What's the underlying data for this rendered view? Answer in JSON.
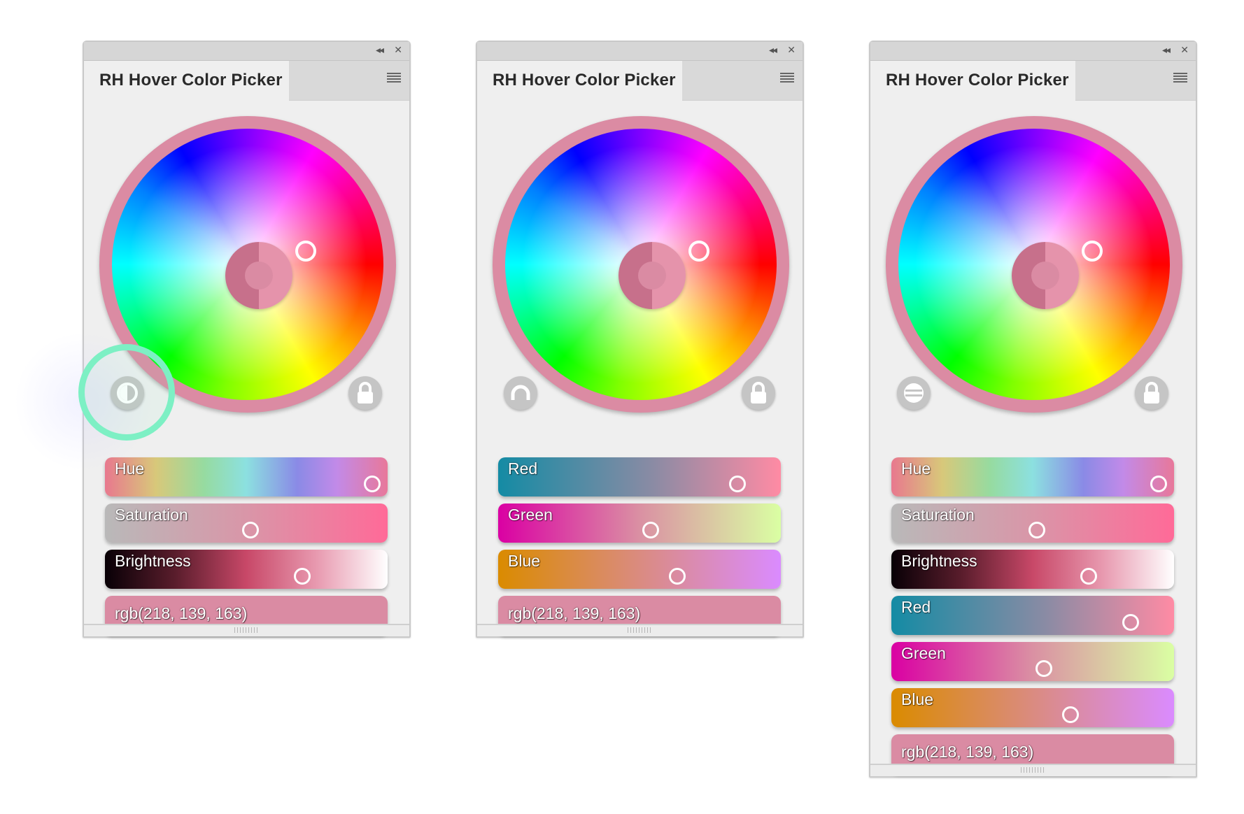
{
  "panels": [
    {
      "title": "RH Hover Color Picker",
      "collapse_icon": "double-chevron-left-icon",
      "close_icon": "close-icon",
      "menu_icon": "hamburger-menu-icon",
      "mode_icon": "half-circle-icon",
      "lock_icon": "lock-icon",
      "sliders": [
        {
          "label": "Hue",
          "value": 0.95
        },
        {
          "label": "Saturation",
          "value": 0.52
        },
        {
          "label": "Brightness",
          "value": 0.7
        }
      ],
      "rgb_text": "rgb(218, 139, 163)"
    },
    {
      "title": "RH Hover Color Picker",
      "collapse_icon": "double-chevron-left-icon",
      "close_icon": "close-icon",
      "menu_icon": "hamburger-menu-icon",
      "mode_icon": "arc-icon",
      "lock_icon": "lock-icon",
      "sliders": [
        {
          "label": "Red",
          "value": 0.85
        },
        {
          "label": "Green",
          "value": 0.55
        },
        {
          "label": "Blue",
          "value": 0.64
        }
      ],
      "rgb_text": "rgb(218, 139, 163)"
    },
    {
      "title": "RH Hover Color Picker",
      "collapse_icon": "double-chevron-left-icon",
      "close_icon": "close-icon",
      "menu_icon": "hamburger-menu-icon",
      "mode_icon": "equals-icon",
      "lock_icon": "lock-icon",
      "sliders": [
        {
          "label": "Hue",
          "value": 0.95
        },
        {
          "label": "Saturation",
          "value": 0.52
        },
        {
          "label": "Brightness",
          "value": 0.7
        },
        {
          "label": "Red",
          "value": 0.85
        },
        {
          "label": "Green",
          "value": 0.55
        },
        {
          "label": "Blue",
          "value": 0.64
        }
      ],
      "rgb_text": "rgb(218, 139, 163)"
    }
  ],
  "colors": {
    "current": "#da8ba3",
    "highlight": "#7df0c4"
  }
}
